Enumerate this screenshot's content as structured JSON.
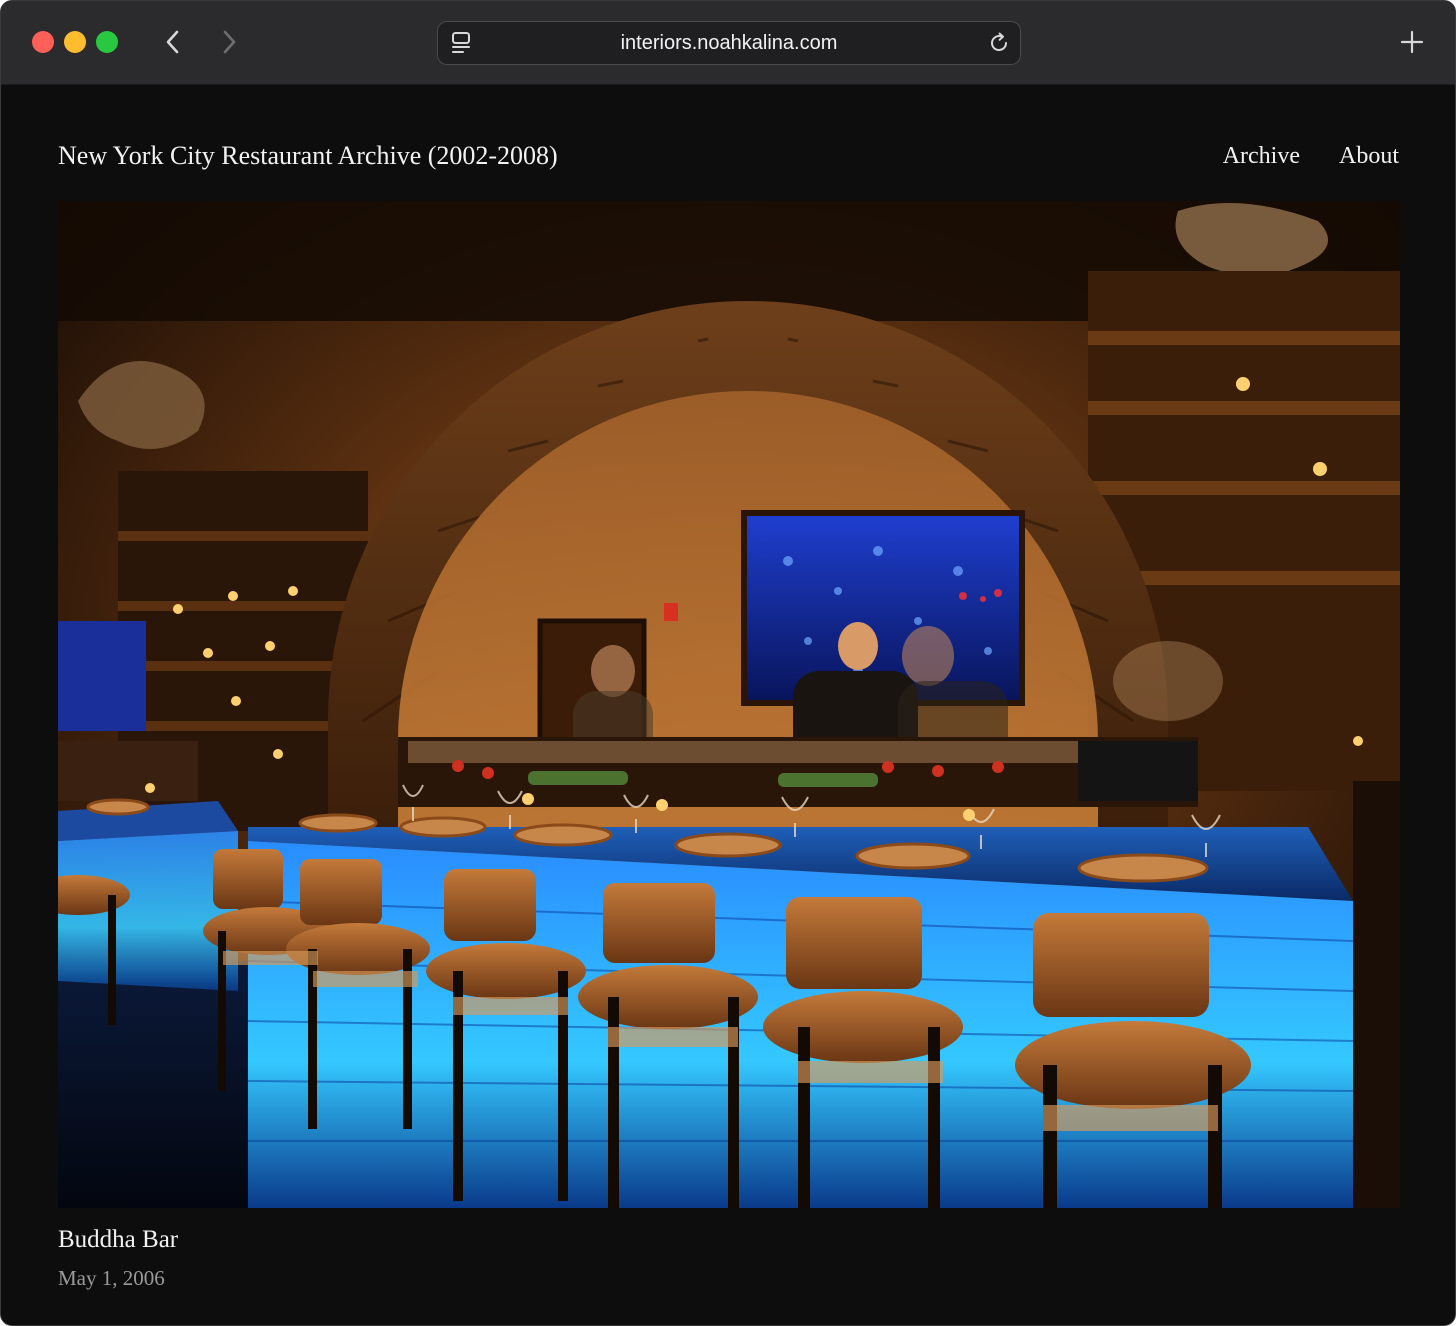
{
  "browser": {
    "url": "interiors.noahkalina.com",
    "icons": {
      "back": "chevron-left-icon",
      "forward": "chevron-right-icon",
      "reader": "reader-view-icon",
      "reload": "reload-icon",
      "new_tab": "plus-icon"
    },
    "colors": {
      "close": "#fe5f57",
      "minimize": "#febc2e",
      "zoom": "#28c840"
    }
  },
  "site": {
    "title": "New York City Restaurant Archive (2002-2008)",
    "nav": [
      {
        "label": "Archive"
      },
      {
        "label": "About"
      }
    ]
  },
  "photo": {
    "caption": "Buddha Bar",
    "date": "May 1, 2006"
  }
}
